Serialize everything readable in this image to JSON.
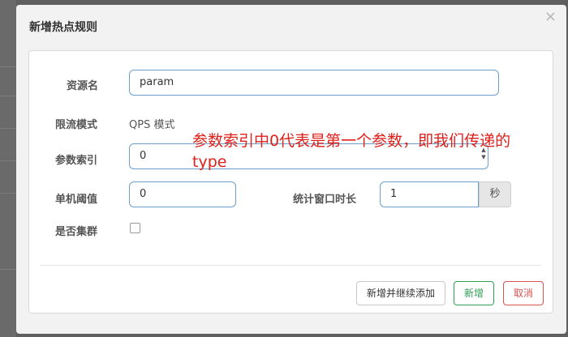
{
  "modal": {
    "title": "新增热点规则",
    "close": "×"
  },
  "form": {
    "resource": {
      "label": "资源名",
      "value": "param"
    },
    "mode": {
      "label": "限流模式",
      "value": "QPS 模式"
    },
    "param_index": {
      "label": "参数索引",
      "value": "0"
    },
    "threshold": {
      "label": "单机阈值",
      "value": "0"
    },
    "window": {
      "label": "统计窗口时长",
      "value": "1",
      "unit": "秒"
    },
    "cluster": {
      "label": "是否集群",
      "checked": false
    }
  },
  "buttons": {
    "add_continue": "新增并继续添加",
    "add": "新增",
    "cancel": "取消"
  },
  "annotation": "参数索引中0代表是第一个参数，即我们传递的type",
  "colors": {
    "add_button": "#2e9f55",
    "cancel_button": "#d9534f",
    "annotation": "#e0201b",
    "input_border": "#6d9ec9"
  }
}
